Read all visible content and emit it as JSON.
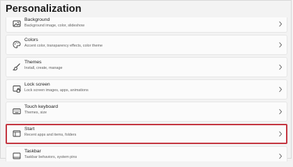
{
  "page": {
    "title": "Personalization"
  },
  "items": [
    {
      "title": "Background",
      "subtitle": "Background image, color, slideshow",
      "icon": "image-icon"
    },
    {
      "title": "Colors",
      "subtitle": "Accent color, transparency effects, color theme",
      "icon": "palette-icon"
    },
    {
      "title": "Themes",
      "subtitle": "Install, create, manage",
      "icon": "brush-icon"
    },
    {
      "title": "Lock screen",
      "subtitle": "Lock screen images, apps, animations",
      "icon": "lock-screen-icon"
    },
    {
      "title": "Touch keyboard",
      "subtitle": "Themes, size",
      "icon": "keyboard-icon"
    },
    {
      "title": "Start",
      "subtitle": "Recent apps and items, folders",
      "icon": "start-menu-icon",
      "highlighted": true
    },
    {
      "title": "Taskbar",
      "subtitle": "Taskbar behaviors, system pins",
      "icon": "taskbar-icon"
    }
  ],
  "colors": {
    "highlight_border": "#c3343f",
    "background": "#f3f3f3",
    "card": "#fbfbfb"
  }
}
